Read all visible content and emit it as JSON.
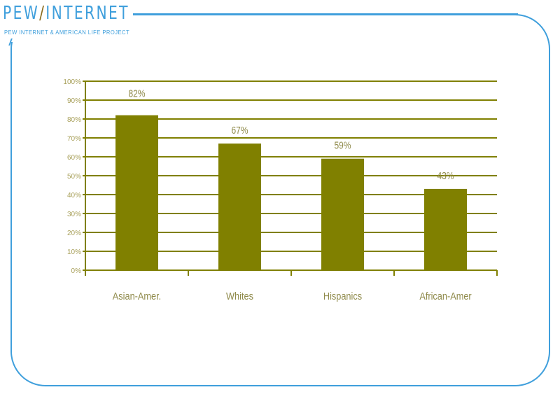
{
  "branding": {
    "title_left": "PEW",
    "title_slash": "/",
    "title_right": "INTERNET",
    "subtitle": "PEW INTERNET & AMERICAN LIFE PROJECT"
  },
  "colors": {
    "bar": "#808000",
    "grid": "#808000",
    "frame": "#3f9fdc"
  },
  "chart_data": {
    "type": "bar",
    "title": "",
    "xlabel": "",
    "ylabel": "",
    "categories": [
      "Asian-Amer.",
      "Whites",
      "Hispanics",
      "African-Amer"
    ],
    "values": [
      82,
      67,
      59,
      43
    ],
    "value_labels": [
      "82%",
      "67%",
      "59%",
      "43%"
    ],
    "ylim": [
      0,
      100
    ],
    "yticks": [
      0,
      10,
      20,
      30,
      40,
      50,
      60,
      70,
      80,
      90,
      100
    ],
    "ytick_labels": [
      "0%",
      "10%",
      "20%",
      "30%",
      "40%",
      "50%",
      "60%",
      "70%",
      "80%",
      "90%",
      "100%"
    ],
    "grid": true,
    "legend": "none"
  }
}
